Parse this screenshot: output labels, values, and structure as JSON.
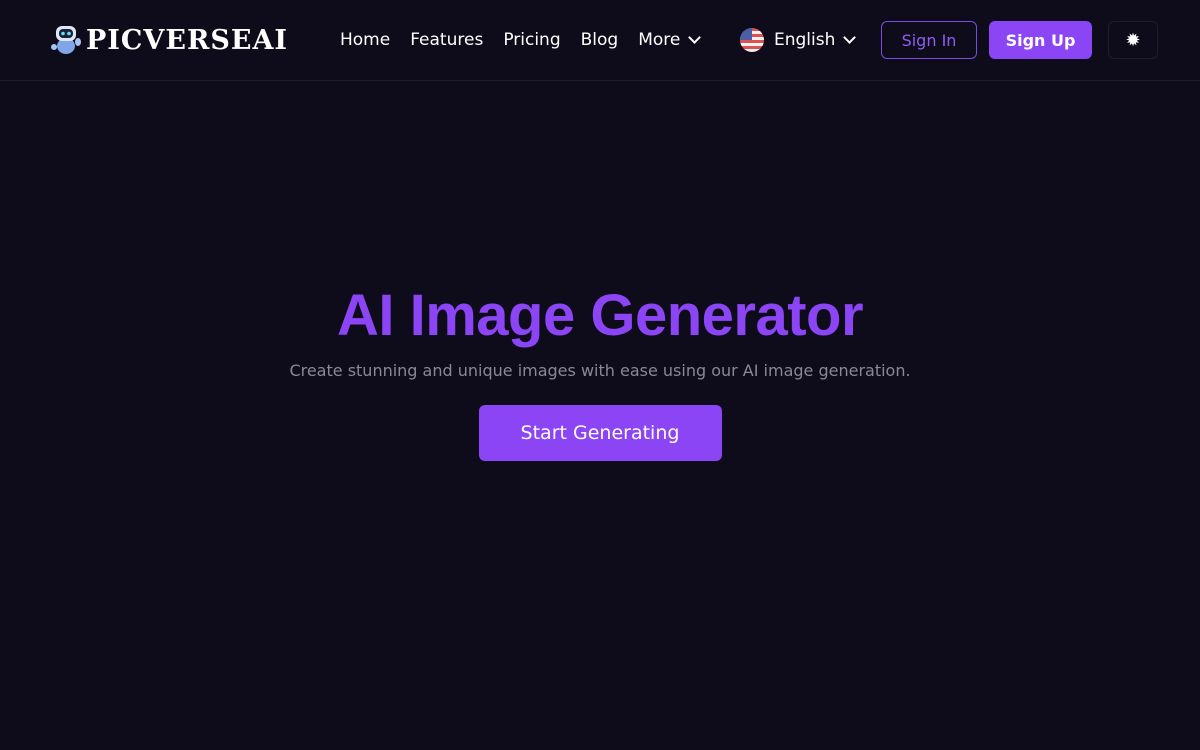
{
  "brand": {
    "name": "PICVERSEAI",
    "accent": "#8b45f5",
    "background": "#0e0c1b"
  },
  "nav": {
    "items": [
      {
        "label": "Home"
      },
      {
        "label": "Features"
      },
      {
        "label": "Pricing"
      },
      {
        "label": "Blog"
      },
      {
        "label": "More"
      }
    ]
  },
  "language": {
    "label": "English",
    "flag": "us-flag-icon"
  },
  "auth": {
    "sign_in": "Sign In",
    "sign_up": "Sign Up"
  },
  "theme_toggle": {
    "icon": "sun-icon",
    "glyph": "✹"
  },
  "hero": {
    "title": "AI Image Generator",
    "subtitle": "Create stunning and unique images with ease using our AI image generation.",
    "cta": "Start Generating"
  }
}
